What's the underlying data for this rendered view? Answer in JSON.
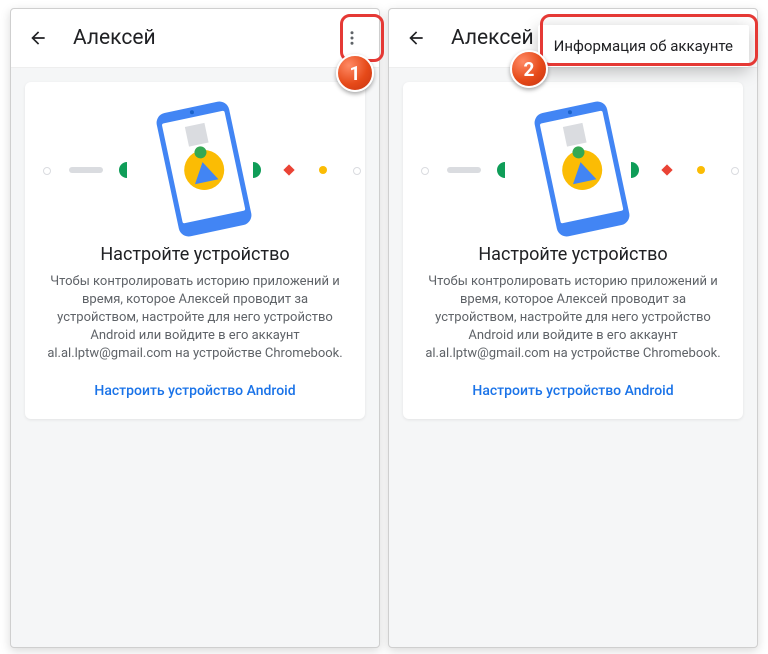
{
  "left": {
    "header": {
      "title": "Алексей"
    },
    "card": {
      "title": "Настройте устройство",
      "desc": "Чтобы контролировать историю приложений и время, которое Алексей проводит за устройством, настройте для него устройство Android или войдите в его аккаунт al.al.lptw@gmail.com на устройстве Chromebook.",
      "cta": "Настроить устройство Android"
    },
    "badge": "1"
  },
  "right": {
    "header": {
      "title": "Алексей"
    },
    "dropdown": {
      "item": "Информация об аккаунте"
    },
    "card": {
      "title": "Настройте устройство",
      "desc": "Чтобы контролировать историю приложений и время, которое Алексей проводит за устройством, настройте для него устройство Android или войдите в его аккаунт al.al.lptw@gmail.com на устройстве Chromebook.",
      "cta": "Настроить устройство Android"
    },
    "badge": "2"
  }
}
